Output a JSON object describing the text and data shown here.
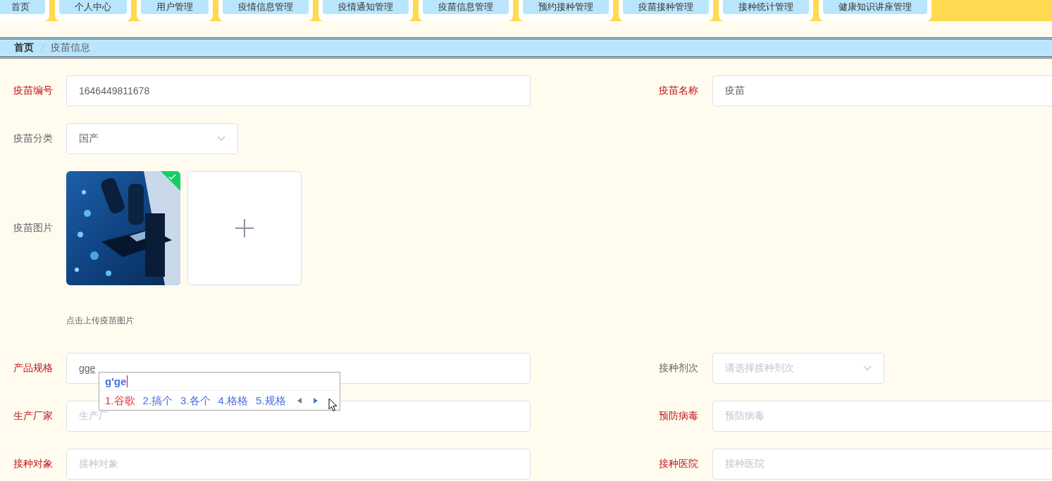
{
  "nav_tabs": [
    {
      "label": "首页"
    },
    {
      "label": "个人中心"
    },
    {
      "label": "用户管理"
    },
    {
      "label": "疫情信息管理"
    },
    {
      "label": "疫情通知管理"
    },
    {
      "label": "疫苗信息管理"
    },
    {
      "label": "预约接种管理"
    },
    {
      "label": "疫苗接种管理"
    },
    {
      "label": "接种统计管理"
    },
    {
      "label": "健康知识讲座管理"
    }
  ],
  "breadcrumb": [
    {
      "label": "首页",
      "current": false
    },
    {
      "label": "疫苗信息",
      "current": true
    }
  ],
  "form": {
    "rows": [
      {
        "fields": [
          {
            "label": "疫苗编号",
            "required": true,
            "kind": "input",
            "value": "1646449811678"
          },
          {
            "label": "疫苗名称",
            "required": true,
            "kind": "input",
            "value": "疫苗"
          }
        ]
      },
      {
        "fields": [
          {
            "label": "疫苗分类",
            "required": false,
            "kind": "select",
            "value": "国产"
          }
        ]
      },
      {
        "fields": [
          {
            "label": "疫苗图片",
            "required": false,
            "kind": "upload",
            "uploaded": true,
            "hint": "点击上传疫苗图片"
          }
        ]
      },
      {
        "fields": [
          {
            "label": "产品规格",
            "required": true,
            "kind": "input",
            "value": "gge",
            "ime": true
          },
          {
            "label": "接种剂次",
            "required": false,
            "kind": "select",
            "placeholder": "请选择接种剂次"
          }
        ]
      },
      {
        "fields": [
          {
            "label": "生产厂家",
            "required": true,
            "kind": "input",
            "placeholder": "生产厂"
          },
          {
            "label": "预防病毒",
            "required": true,
            "kind": "input",
            "placeholder": "预防病毒"
          }
        ]
      },
      {
        "fields": [
          {
            "label": "接种对象",
            "required": true,
            "kind": "input",
            "placeholder": "接种对象"
          },
          {
            "label": "接种医院",
            "required": true,
            "kind": "input",
            "placeholder": "接种医院"
          }
        ]
      }
    ]
  },
  "ime": {
    "composition": "g'ge",
    "candidates": [
      {
        "text": "1.谷歌",
        "selected": true
      },
      {
        "text": "2.搞个",
        "selected": false
      },
      {
        "text": "3.各个",
        "selected": false
      },
      {
        "text": "4.格格",
        "selected": false
      },
      {
        "text": "5.规格",
        "selected": false
      }
    ]
  }
}
